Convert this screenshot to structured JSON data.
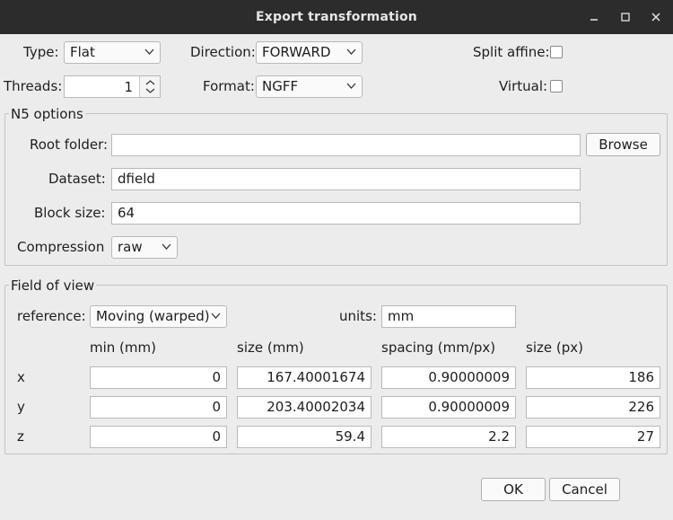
{
  "window": {
    "title": "Export transformation"
  },
  "controls": {
    "type_label": "Type:",
    "type_value": "Flat",
    "direction_label": "Direction:",
    "direction_value": "FORWARD",
    "split_affine_label": "Split affine:",
    "split_affine_checked": false,
    "threads_label": "Threads:",
    "threads_value": "1",
    "format_label": "Format:",
    "format_value": "NGFF",
    "virtual_label": "Virtual:",
    "virtual_checked": false
  },
  "n5": {
    "group_title": "N5 options",
    "root_label": "Root folder:",
    "root_value": "",
    "browse_label": "Browse",
    "dataset_label": "Dataset:",
    "dataset_value": "dfield",
    "block_label": "Block size:",
    "block_value": "64",
    "compression_label": "Compression",
    "compression_value": "raw"
  },
  "fov": {
    "group_title": "Field of view",
    "reference_label": "reference:",
    "reference_value": "Moving (warped)",
    "units_label": "units:",
    "units_value": "mm",
    "headers": [
      "min (mm)",
      "size (mm)",
      "spacing (mm/px)",
      "size (px)"
    ],
    "rows": [
      {
        "axis": "x",
        "min": "0",
        "size_mm": "167.40001674",
        "spacing": "0.90000009",
        "size_px": "186"
      },
      {
        "axis": "y",
        "min": "0",
        "size_mm": "203.40002034",
        "spacing": "0.90000009",
        "size_px": "226"
      },
      {
        "axis": "z",
        "min": "0",
        "size_mm": "59.4",
        "spacing": "2.2",
        "size_px": "27"
      }
    ]
  },
  "footer": {
    "ok_label": "OK",
    "cancel_label": "Cancel"
  }
}
